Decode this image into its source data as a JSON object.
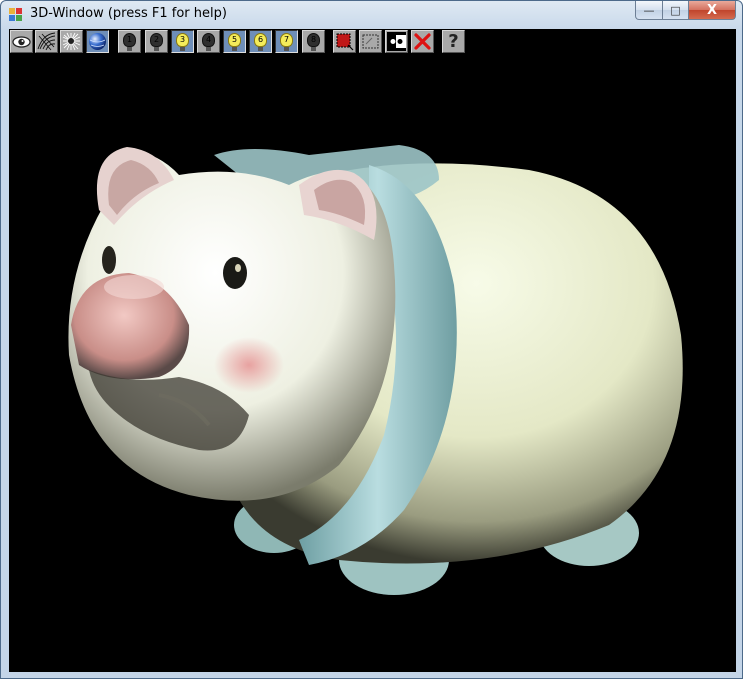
{
  "window": {
    "title": "3D-Window (press F1 for help)"
  },
  "caption_buttons": {
    "minimize": "—",
    "maximize": "□",
    "close": "X"
  },
  "toolbar": {
    "buttons": [
      {
        "name": "view-eye-icon"
      },
      {
        "name": "wireframe-icon"
      },
      {
        "name": "points-icon"
      },
      {
        "name": "shaded-sphere-icon"
      },
      {
        "name": "light-1-icon",
        "label": "1",
        "on": false
      },
      {
        "name": "light-2-icon",
        "label": "2",
        "on": false
      },
      {
        "name": "light-3-icon",
        "label": "3",
        "on": true
      },
      {
        "name": "light-4-icon",
        "label": "4",
        "on": false
      },
      {
        "name": "light-5-icon",
        "label": "5",
        "on": true
      },
      {
        "name": "light-6-icon",
        "label": "6",
        "on": true
      },
      {
        "name": "light-7-icon",
        "label": "7",
        "on": true
      },
      {
        "name": "light-8-icon",
        "label": "8",
        "on": false
      },
      {
        "name": "select-region-icon"
      },
      {
        "name": "deselect-region-icon"
      },
      {
        "name": "toggle-points-icon"
      },
      {
        "name": "delete-icon"
      },
      {
        "name": "help-icon",
        "label": "?"
      }
    ]
  },
  "viewport": {
    "background": "#000000",
    "model": "piggy bank"
  }
}
